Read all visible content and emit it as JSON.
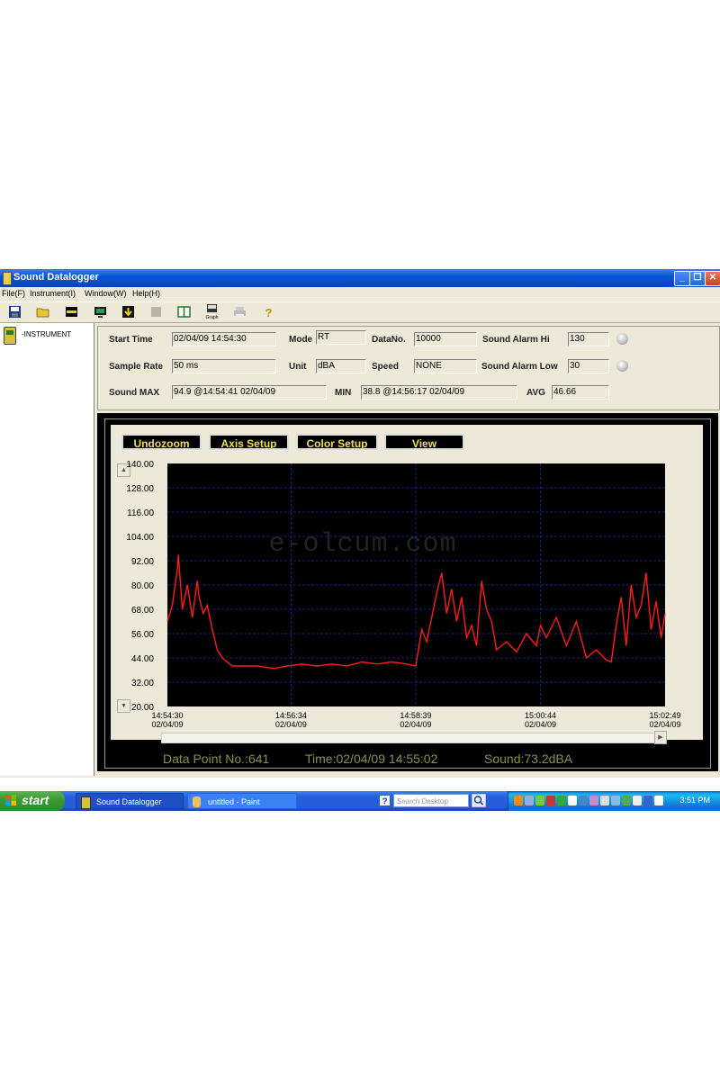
{
  "window": {
    "title": "Sound Datalogger",
    "controls": {
      "minimize": "_",
      "maximize": "❐",
      "close": "✕"
    }
  },
  "menu": [
    "File(F)",
    "Instrument(I)",
    "Window(W)",
    "Help(H)"
  ],
  "toolbar_icons": [
    "save-icon",
    "open-folder-icon",
    "connect-icon",
    "monitor-icon",
    "download-icon",
    "stop-icon",
    "split-view-icon",
    "graph-icon",
    "print-icon",
    "help-icon"
  ],
  "toolbar_graph_label": "Graph",
  "sidebar": {
    "instrument_label": "-INSTRUMENT"
  },
  "info": {
    "start_time_label": "Start Time",
    "start_time": "02/04/09 14:54:30",
    "mode_label": "Mode",
    "mode": "RT",
    "datano_label": "DataNo.",
    "datano": "10000",
    "alarm_hi_label": "Sound Alarm Hi",
    "alarm_hi": "130",
    "sample_rate_label": "Sample Rate",
    "sample_rate": "50 ms",
    "unit_label": "Unit",
    "unit": "dBA",
    "speed_label": "Speed",
    "speed": "NONE",
    "alarm_low_label": "Sound Alarm Low",
    "alarm_low": "30",
    "sound_max_label": "Sound MAX",
    "sound_max": "94.9 @14:54:41 02/04/09",
    "min_label": "MIN",
    "min": "38.8 @14:56:17 02/04/09",
    "avg_label": "AVG",
    "avg": "46.66"
  },
  "graph_buttons": {
    "undozoom": "Undozoom",
    "axis_setup": "Axis Setup",
    "color_setup": "Color Setup",
    "view": "View"
  },
  "watermark": "e-olcum.com",
  "status": {
    "data_point": "Data Point No.:641",
    "time": "Time:02/04/09 14:55:02",
    "sound": "Sound:73.2dBA"
  },
  "chart_data": {
    "type": "line",
    "ylim": [
      20,
      140
    ],
    "yticks": [
      "140.00",
      "128.00",
      "116.00",
      "104.00",
      "92.00",
      "80.00",
      "68.00",
      "56.00",
      "44.00",
      "32.00",
      "20.00"
    ],
    "xticks": [
      {
        "time": "14:54:30",
        "date": "02/04/09"
      },
      {
        "time": "14:56:34",
        "date": "02/04/09"
      },
      {
        "time": "14:58:39",
        "date": "02/04/09"
      },
      {
        "time": "15:00:44",
        "date": "02/04/09"
      },
      {
        "time": "15:02:49",
        "date": "02/04/09"
      }
    ],
    "grid": true,
    "colors": {
      "background": "#000000",
      "line": "#ff1a1a",
      "grid": "#1a2aa8",
      "axis_text": "#000000"
    },
    "series": [
      {
        "x": [
          "14:54:30",
          "14:54:35",
          "14:54:40",
          "14:54:41",
          "14:54:45",
          "14:54:50",
          "14:54:55",
          "14:55:00",
          "14:55:02",
          "14:55:06",
          "14:55:10",
          "14:55:15",
          "14:55:20",
          "14:55:25",
          "14:55:30",
          "14:55:35",
          "14:55:40",
          "14:55:50",
          "14:56:00",
          "14:56:17",
          "14:56:30",
          "14:56:45",
          "14:57:00",
          "14:57:15",
          "14:57:30",
          "14:57:45",
          "14:58:00",
          "14:58:15",
          "14:58:30",
          "14:58:39",
          "14:58:45",
          "14:58:50",
          "14:58:55",
          "14:59:00",
          "14:59:05",
          "14:59:10",
          "14:59:15",
          "14:59:20",
          "14:59:25",
          "14:59:30",
          "14:59:35",
          "14:59:40",
          "14:59:45",
          "14:59:50",
          "14:59:55",
          "15:00:00",
          "15:00:10",
          "15:00:20",
          "15:00:30",
          "15:00:40",
          "15:00:44",
          "15:00:50",
          "15:01:00",
          "15:01:10",
          "15:01:20",
          "15:01:30",
          "15:01:40",
          "15:01:50",
          "15:01:55",
          "15:02:00",
          "15:02:05",
          "15:02:10",
          "15:02:15",
          "15:02:20",
          "15:02:25",
          "15:02:30",
          "15:02:35",
          "15:02:40",
          "15:02:45",
          "15:02:49"
        ],
        "y": [
          62,
          70,
          88,
          94.9,
          68,
          80,
          64,
          82,
          73.2,
          66,
          70,
          58,
          48,
          44,
          42,
          40,
          40,
          40,
          40,
          38.8,
          40,
          41,
          40,
          41,
          40,
          42,
          41,
          42,
          41,
          40,
          58,
          52,
          64,
          76,
          86,
          66,
          78,
          62,
          74,
          54,
          60,
          50,
          82,
          68,
          62,
          48,
          52,
          47,
          56,
          50,
          60,
          54,
          64,
          50,
          62,
          44,
          48,
          43,
          42,
          60,
          74,
          50,
          80,
          64,
          70,
          86,
          58,
          72,
          54,
          66
        ]
      }
    ]
  },
  "taskbar": {
    "start": "start",
    "tasks": [
      "Sound Datalogger",
      "untitled - Paint"
    ],
    "search_placeholder": "Search Desktop",
    "clock": "3:51 PM"
  }
}
